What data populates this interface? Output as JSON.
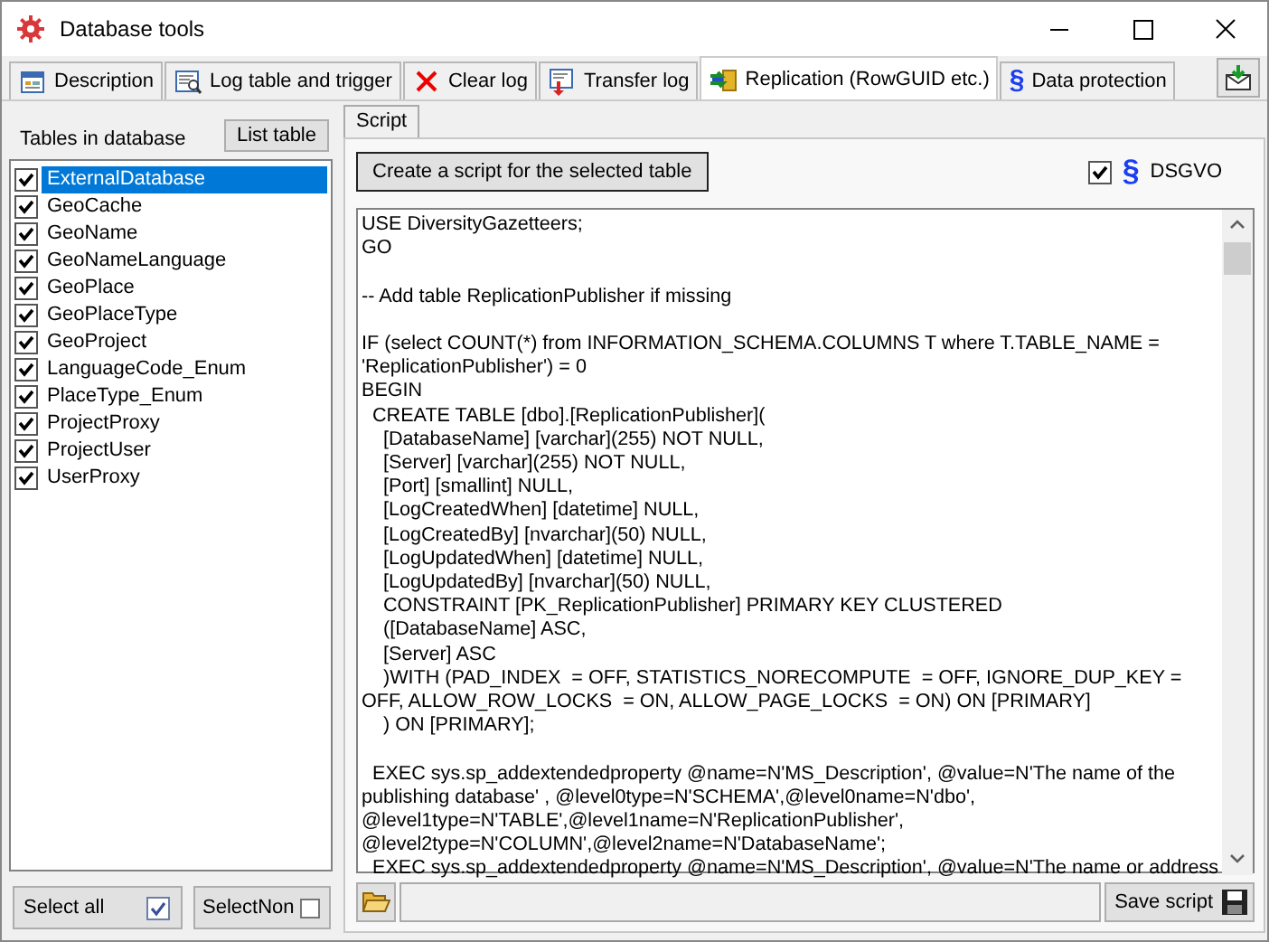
{
  "window": {
    "title": "Database tools"
  },
  "tabs": [
    {
      "label": "Description",
      "selected": false
    },
    {
      "label": "Log table and trigger",
      "selected": false
    },
    {
      "label": "Clear log",
      "selected": false
    },
    {
      "label": "Transfer log",
      "selected": false
    },
    {
      "label": "Replication (RowGUID etc.)",
      "selected": true
    },
    {
      "label": "Data protection",
      "selected": false,
      "glyph": "§"
    }
  ],
  "tables_panel": {
    "label": "Tables in database",
    "list_button": "List table",
    "items": [
      {
        "name": "ExternalDatabase",
        "checked": true,
        "selected": true
      },
      {
        "name": "GeoCache",
        "checked": true,
        "selected": false
      },
      {
        "name": "GeoName",
        "checked": true,
        "selected": false
      },
      {
        "name": "GeoNameLanguage",
        "checked": true,
        "selected": false
      },
      {
        "name": "GeoPlace",
        "checked": true,
        "selected": false
      },
      {
        "name": "GeoPlaceType",
        "checked": true,
        "selected": false
      },
      {
        "name": "GeoProject",
        "checked": true,
        "selected": false
      },
      {
        "name": "LanguageCode_Enum",
        "checked": true,
        "selected": false
      },
      {
        "name": "PlaceType_Enum",
        "checked": true,
        "selected": false
      },
      {
        "name": "ProjectProxy",
        "checked": true,
        "selected": false
      },
      {
        "name": "ProjectUser",
        "checked": true,
        "selected": false
      },
      {
        "name": "UserProxy",
        "checked": true,
        "selected": false
      }
    ],
    "select_all": "Select all",
    "select_none": "SelectNon"
  },
  "inner_tabs": [
    {
      "label": "Script",
      "selected": true
    }
  ],
  "script_panel": {
    "create_button": "Create a script for the selected table",
    "dsgvo": {
      "label": "DSGVO",
      "checked": true,
      "glyph": "§"
    },
    "script_blocks": [
      [
        "USE DiversityGazetteers;",
        "GO"
      ],
      [
        "-- Add table ReplicationPublisher if missing"
      ],
      [
        "IF (select COUNT(*) from INFORMATION_SCHEMA.COLUMNS T where T.TABLE_NAME =",
        "'ReplicationPublisher') = 0",
        "BEGIN",
        "  CREATE TABLE [dbo].[ReplicationPublisher](",
        "    [DatabaseName] [varchar](255) NOT NULL,",
        "    [Server] [varchar](255) NOT NULL,",
        "    [Port] [smallint] NULL,",
        "    [LogCreatedWhen] [datetime] NULL,",
        "    [LogCreatedBy] [nvarchar](50) NULL,",
        "    [LogUpdatedWhen] [datetime] NULL,",
        "    [LogUpdatedBy] [nvarchar](50) NULL,",
        "    CONSTRAINT [PK_ReplicationPublisher] PRIMARY KEY CLUSTERED",
        "    ([DatabaseName] ASC,",
        "    [Server] ASC",
        "    )WITH (PAD_INDEX  = OFF, STATISTICS_NORECOMPUTE  = OFF, IGNORE_DUP_KEY =",
        "OFF, ALLOW_ROW_LOCKS  = ON, ALLOW_PAGE_LOCKS  = ON) ON [PRIMARY]",
        "    ) ON [PRIMARY];"
      ],
      [
        "  EXEC sys.sp_addextendedproperty @name=N'MS_Description', @value=N'The name of the",
        "publishing database' , @level0type=N'SCHEMA',@level0name=N'dbo',",
        "@level1type=N'TABLE',@level1name=N'ReplicationPublisher',",
        "@level2type=N'COLUMN',@level2name=N'DatabaseName';",
        "  EXEC sys.sp_addextendedproperty @name=N'MS_Description', @value=N'The name or address"
      ]
    ],
    "save_button": "Save script"
  }
}
